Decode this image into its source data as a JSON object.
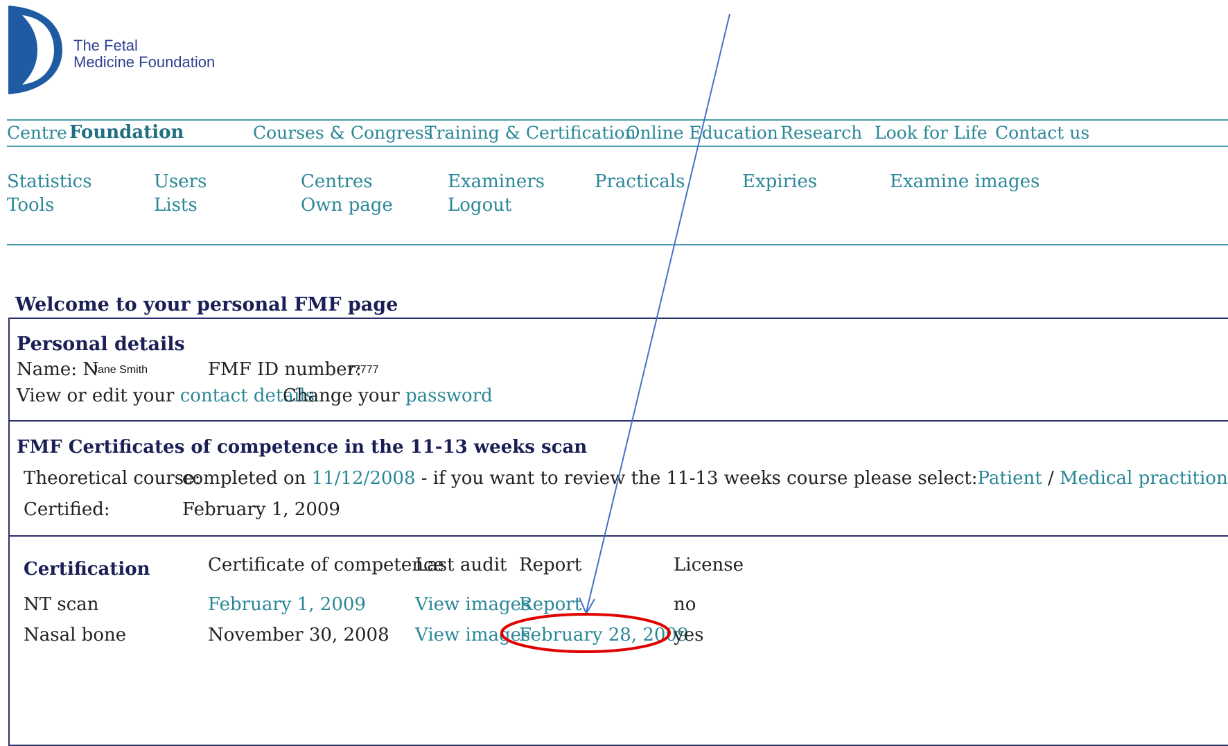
{
  "logo": {
    "line1": "The Fetal",
    "line2": "Medicine Foundation"
  },
  "top_nav": {
    "centre": "Centre",
    "foundation": "Foundation",
    "items": [
      "Courses & Congress",
      "Training & Certification",
      "Online Education",
      "Research",
      "Look for Life",
      "Contact us"
    ]
  },
  "sub_nav": {
    "row1": [
      "Statistics",
      "Users",
      "Centres",
      "Examiners",
      "Practicals",
      "Expiries",
      "Examine images"
    ],
    "row2": [
      "Tools",
      "Lists",
      "Own page",
      "Logout"
    ]
  },
  "welcome": "Welcome to your personal FMF page",
  "personal": {
    "heading": "Personal details",
    "name_label": "Name: N",
    "name_value": "Jane Smith",
    "id_label": "FMF ID number:",
    "id_value": "77777",
    "view_text": "View or edit your",
    "contact_link": "contact details",
    "change_text": "Change your",
    "password_link": "password"
  },
  "certificates": {
    "heading": "FMF Certificates of competence in the 11-13 weeks scan",
    "theory_label": "Theoretical course:",
    "completed_text": "completed on",
    "completed_date": "11/12/2008",
    "review_text": "- if you want to review the 11-13 weeks course please select:",
    "patient_link": "Patient",
    "slash": "/",
    "practitioner_link": "Medical practitioner",
    "certified_label": "Certified:",
    "certified_date": "February 1, 2009"
  },
  "certification": {
    "heading": "Certification",
    "columns": [
      "Certificate of competence",
      "Last audit",
      "Report",
      "License"
    ],
    "rows": [
      {
        "name": "NT scan",
        "certificate": "February 1, 2009",
        "last_audit": "View images",
        "report": "Report",
        "license": "no"
      },
      {
        "name": "Nasal bone",
        "certificate": "November 30, 2008",
        "last_audit": "View images",
        "report": "February 28, 2009",
        "license": "yes"
      }
    ]
  },
  "annotation": {
    "arrow_color": "#4472c4",
    "circle_color": "#e00000"
  }
}
